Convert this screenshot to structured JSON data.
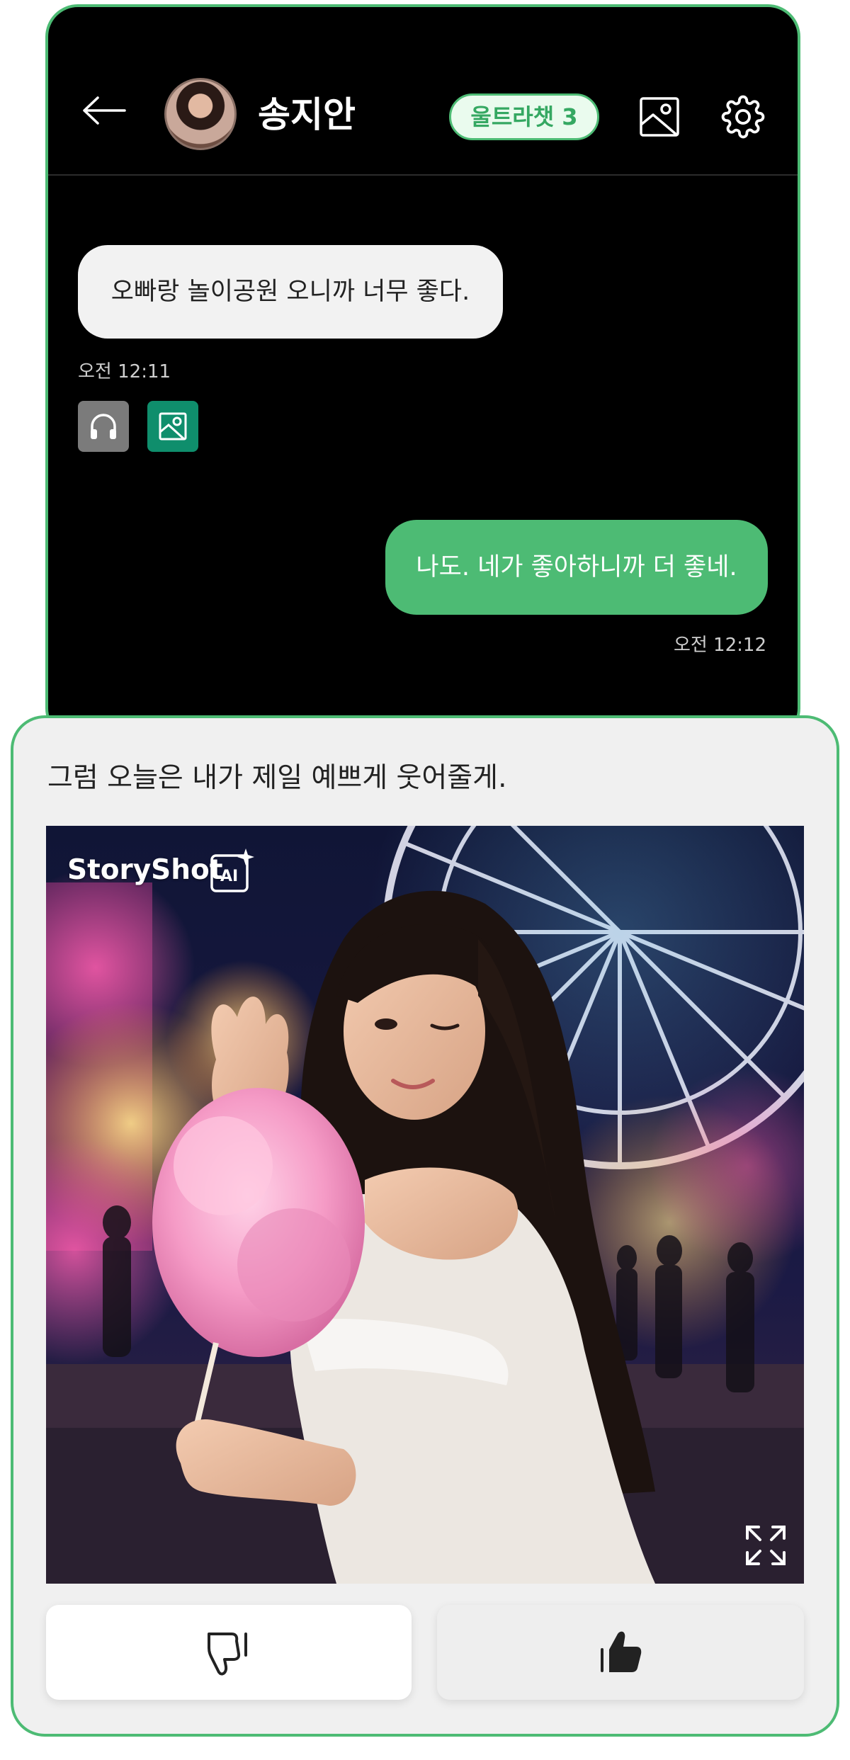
{
  "header": {
    "contact_name": "송지안",
    "badge": "울트라챗 3"
  },
  "messages": [
    {
      "from": "contact",
      "text": "오빠랑 놀이공원 오니까 너무 좋다.",
      "time": "오전 12:11"
    },
    {
      "from": "me",
      "text": "나도. 네가 좋아하니까 더 좋네.",
      "time": "오전 12:12"
    }
  ],
  "card": {
    "text": "그럼 오늘은 내가 제일 예쁘게 웃어줄게.",
    "brand": "StoryShot",
    "ai_badge": "AI"
  },
  "icons": {
    "back": "arrow-left-icon",
    "header_image": "image-icon",
    "settings": "gear-icon",
    "audio": "headphones-icon",
    "photo": "image-icon",
    "expand": "expand-icon",
    "dislike": "thumbs-down-icon",
    "like": "thumbs-up-icon"
  },
  "colors": {
    "accent": "#4dbb74",
    "photo_button": "#0f8e6c",
    "audio_button": "#7b7b7b"
  }
}
